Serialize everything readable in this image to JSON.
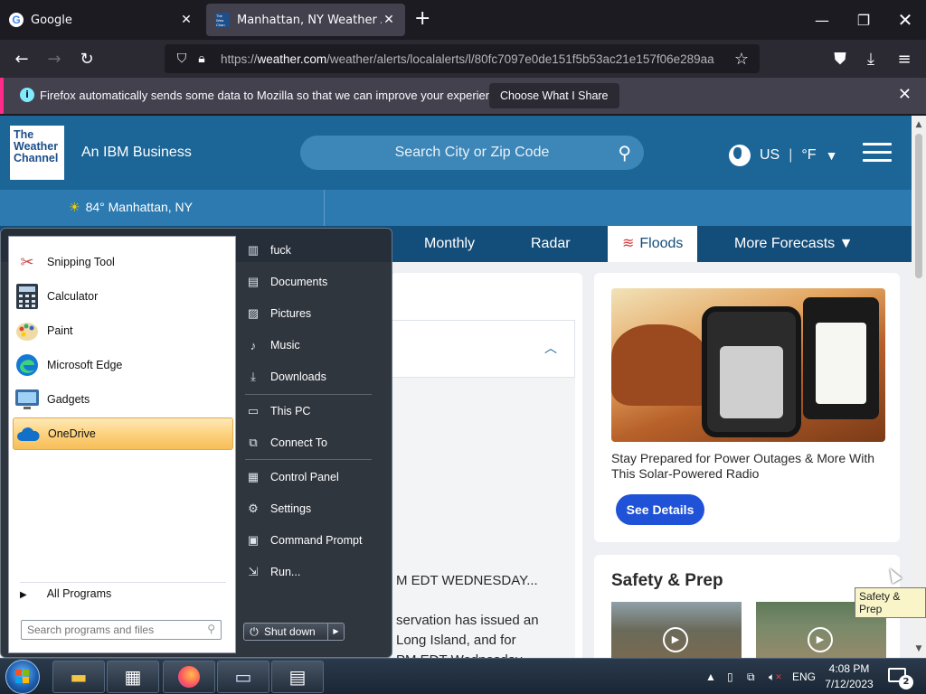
{
  "browser": {
    "tabs": [
      {
        "title": "Google",
        "favicon": "google-icon",
        "active": false
      },
      {
        "title": "Manhattan, NY Weather Alerts",
        "favicon": "weather-channel-icon",
        "active": true
      }
    ],
    "url_prefix": "https://",
    "url_domain": "weather.com",
    "url_path": "/weather/alerts/localalerts/l/80fc7097e0de151f5b53ac21e157f06e289aa",
    "notification": {
      "message": "Firefox automatically sends some data to Mozilla so that we can improve your experience.",
      "button": "Choose What I Share"
    }
  },
  "site": {
    "logo_text": [
      "The",
      "Weather",
      "Channel"
    ],
    "tagline": "An IBM Business",
    "search_placeholder": "Search City or Zip Code",
    "locale_country": "US",
    "locale_unit": "°F",
    "location_temp": "84° Manhattan, NY",
    "nav": [
      "Monthly",
      "Radar",
      "Floods",
      "More Forecasts"
    ],
    "active_nav": "Floods",
    "alert_text": {
      "line1": "M EDT WEDNESDAY...",
      "line2": "servation has issued an",
      "line3": "Long Island, and for",
      "line4": "PM EDT Wednesday"
    },
    "promo": {
      "text": "Stay Prepared for Power Outages & More With This Solar-Powered Radio",
      "button": "See Details"
    },
    "safety": {
      "heading": "Safety & Prep"
    },
    "tooltip": "Safety & Prep"
  },
  "start_menu": {
    "programs": [
      {
        "label": "Snipping Tool",
        "icon": "scissors-icon"
      },
      {
        "label": "Calculator",
        "icon": "calculator-icon"
      },
      {
        "label": "Paint",
        "icon": "palette-icon"
      },
      {
        "label": "Microsoft Edge",
        "icon": "edge-icon"
      },
      {
        "label": "Gadgets",
        "icon": "gadgets-icon"
      },
      {
        "label": "OneDrive",
        "icon": "cloud-icon"
      }
    ],
    "all_programs": "All Programs",
    "search_placeholder": "Search programs and files",
    "places": [
      {
        "label": "fuck",
        "icon": "user-folder-icon"
      },
      {
        "label": "Documents",
        "icon": "documents-icon"
      },
      {
        "label": "Pictures",
        "icon": "pictures-icon"
      },
      {
        "label": "Music",
        "icon": "music-icon"
      },
      {
        "label": "Downloads",
        "icon": "downloads-icon"
      },
      {
        "label": "This PC",
        "icon": "computer-icon"
      },
      {
        "label": "Connect To",
        "icon": "network-icon"
      },
      {
        "label": "Control Panel",
        "icon": "control-panel-icon"
      },
      {
        "label": "Settings",
        "icon": "gear-icon"
      },
      {
        "label": "Command Prompt",
        "icon": "terminal-icon"
      },
      {
        "label": "Run...",
        "icon": "run-icon"
      }
    ],
    "shutdown": "Shut down"
  },
  "taskbar": {
    "language": "ENG",
    "time": "4:08 PM",
    "date": "7/12/2023",
    "notification_count": "2"
  }
}
